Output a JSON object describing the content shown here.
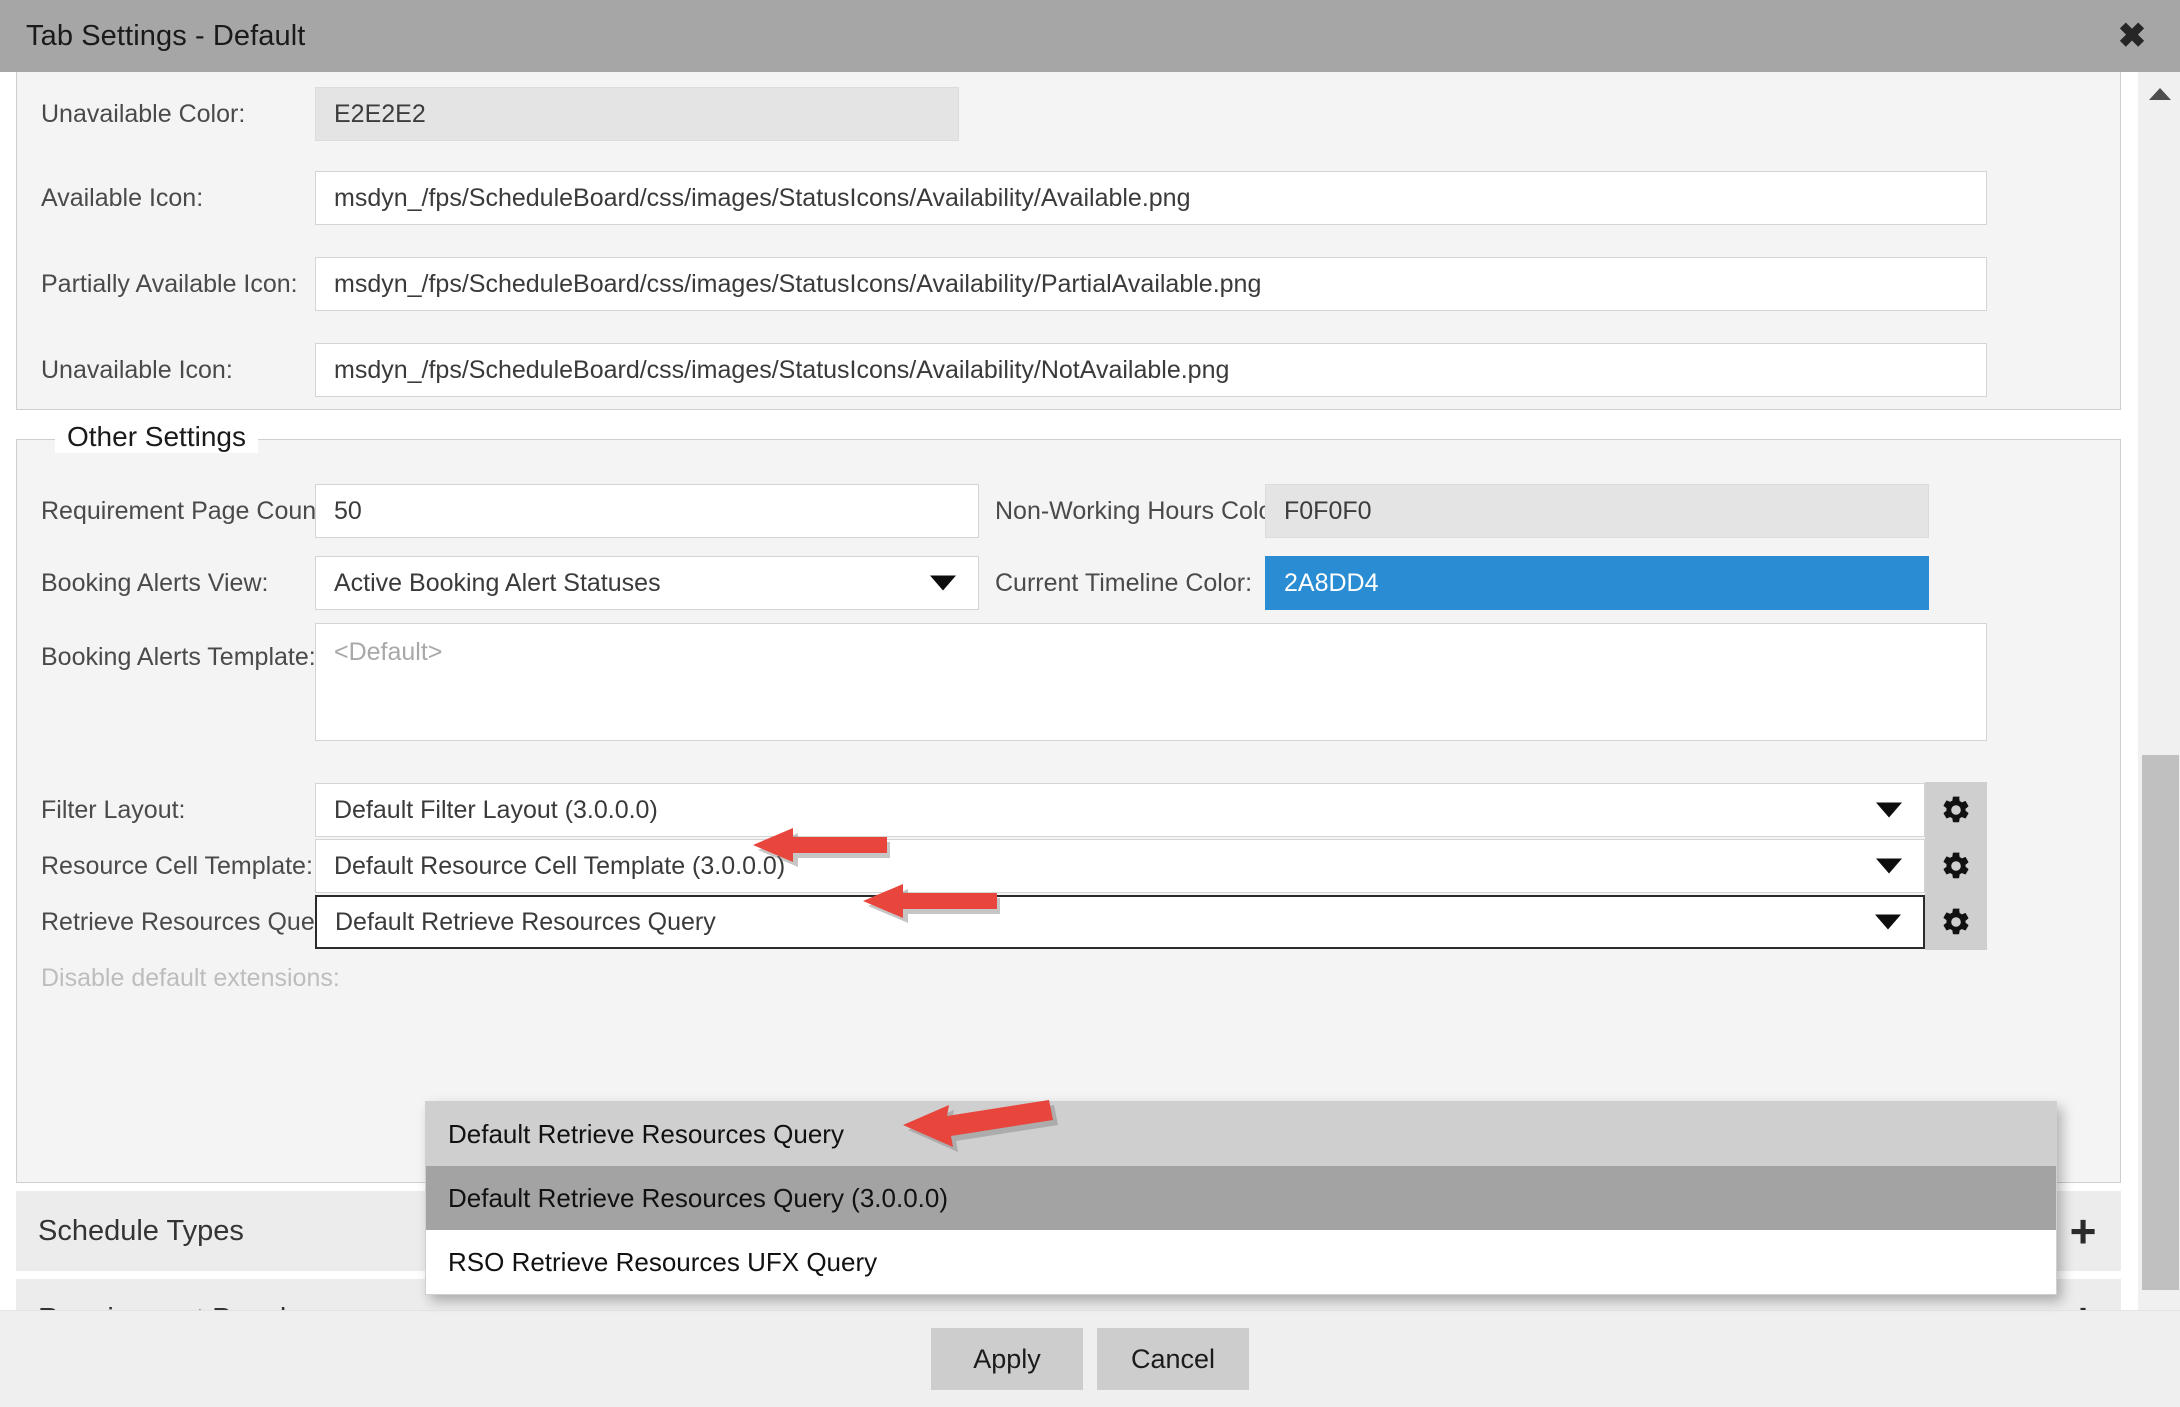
{
  "window": {
    "title": "Tab Settings - Default",
    "close_icon": "close-icon"
  },
  "top_group": {
    "rows": [
      {
        "label": "Unavailable Color:",
        "value": "E2E2E2",
        "type": "readonly-color"
      },
      {
        "label": "Available Icon:",
        "value": "msdyn_/fps/ScheduleBoard/css/images/StatusIcons/Availability/Available.png",
        "type": "text"
      },
      {
        "label": "Partially Available Icon:",
        "value": "msdyn_/fps/ScheduleBoard/css/images/StatusIcons/Availability/PartialAvailable.png",
        "type": "text"
      },
      {
        "label": "Unavailable Icon:",
        "value": "msdyn_/fps/ScheduleBoard/css/images/StatusIcons/Availability/NotAvailable.png",
        "type": "text"
      }
    ]
  },
  "other_settings": {
    "legend": "Other Settings",
    "requirement_page_count": {
      "label": "Requirement Page Count:",
      "value": "50"
    },
    "non_working_hours_color": {
      "label": "Non-Working Hours Color:",
      "value": "F0F0F0"
    },
    "booking_alerts_view": {
      "label": "Booking Alerts View:",
      "value": "Active Booking Alert Statuses"
    },
    "current_timeline_color": {
      "label": "Current Timeline Color:",
      "value": "2A8DD4",
      "color": "#2A8DD4"
    },
    "booking_alerts_template": {
      "label": "Booking Alerts Template:",
      "placeholder": "<Default>",
      "value": ""
    },
    "filter_layout": {
      "label": "Filter Layout:",
      "value": "Default Filter Layout (3.0.0.0)",
      "gear_icon": "gear-icon"
    },
    "resource_cell_template": {
      "label": "Resource Cell Template:",
      "value": "Default Resource Cell Template (3.0.0.0)",
      "gear_icon": "gear-icon"
    },
    "retrieve_resources_query": {
      "label": "Retrieve Resources Query:",
      "value": "Default Retrieve Resources Query",
      "gear_icon": "gear-icon"
    },
    "disable_default_extensions": {
      "label": "Disable default extensions:",
      "disabled": true
    }
  },
  "dropdown": {
    "options": [
      {
        "label": "Default Retrieve Resources Query",
        "state": "hover"
      },
      {
        "label": "Default Retrieve Resources Query (3.0.0.0)",
        "state": "selected"
      },
      {
        "label": "RSO Retrieve Resources UFX Query",
        "state": "normal"
      }
    ]
  },
  "accordions": [
    {
      "title": "Schedule Types",
      "expand_icon": "plus-icon"
    },
    {
      "title": "Requirement Panels",
      "expand_icon": "plus-icon"
    }
  ],
  "footer": {
    "apply_label": "Apply",
    "cancel_label": "Cancel"
  },
  "scrollbar": {
    "up_icon": "chevron-up-icon",
    "down_icon": "chevron-down-icon"
  },
  "annotations": {
    "arrow_color": "#E8453C",
    "count": 3
  }
}
